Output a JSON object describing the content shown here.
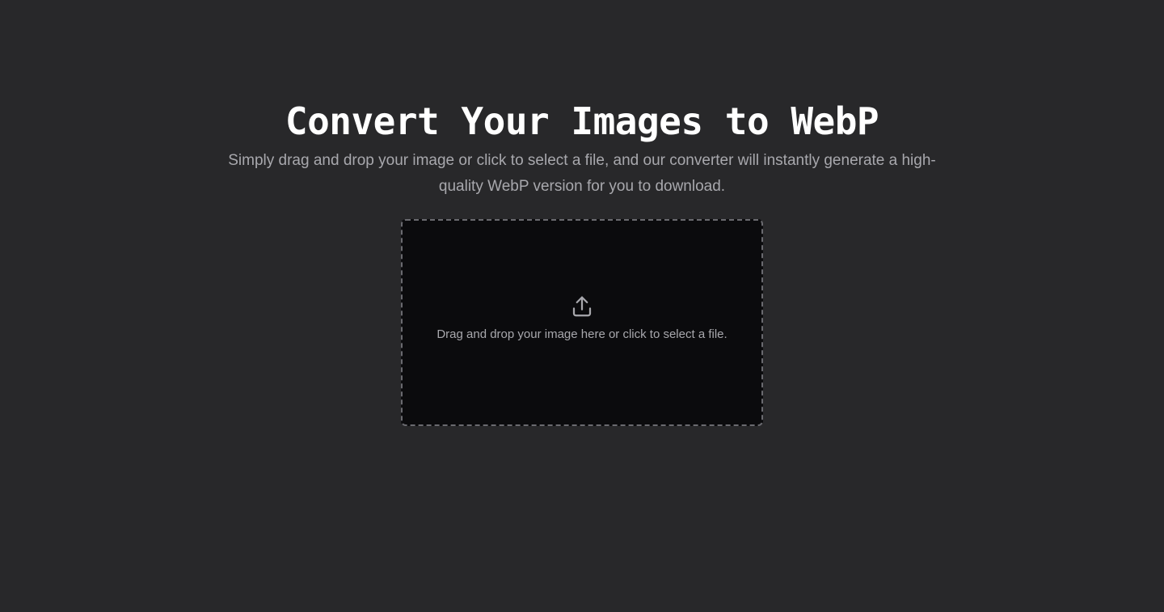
{
  "hero": {
    "title": "Convert Your Images to WebP",
    "subtitle": "Simply drag and drop your image or click to select a file, and our converter will instantly generate a high-quality WebP version for you to download."
  },
  "dropzone": {
    "icon": "upload-icon",
    "text": "Drag and drop your image here or click to select a file."
  },
  "colors": {
    "background": "#28282a",
    "dropzone_background": "#0b0b0d",
    "dropzone_border": "#6a6a6f",
    "title": "#ffffff",
    "muted_text": "#a8a8ad"
  }
}
